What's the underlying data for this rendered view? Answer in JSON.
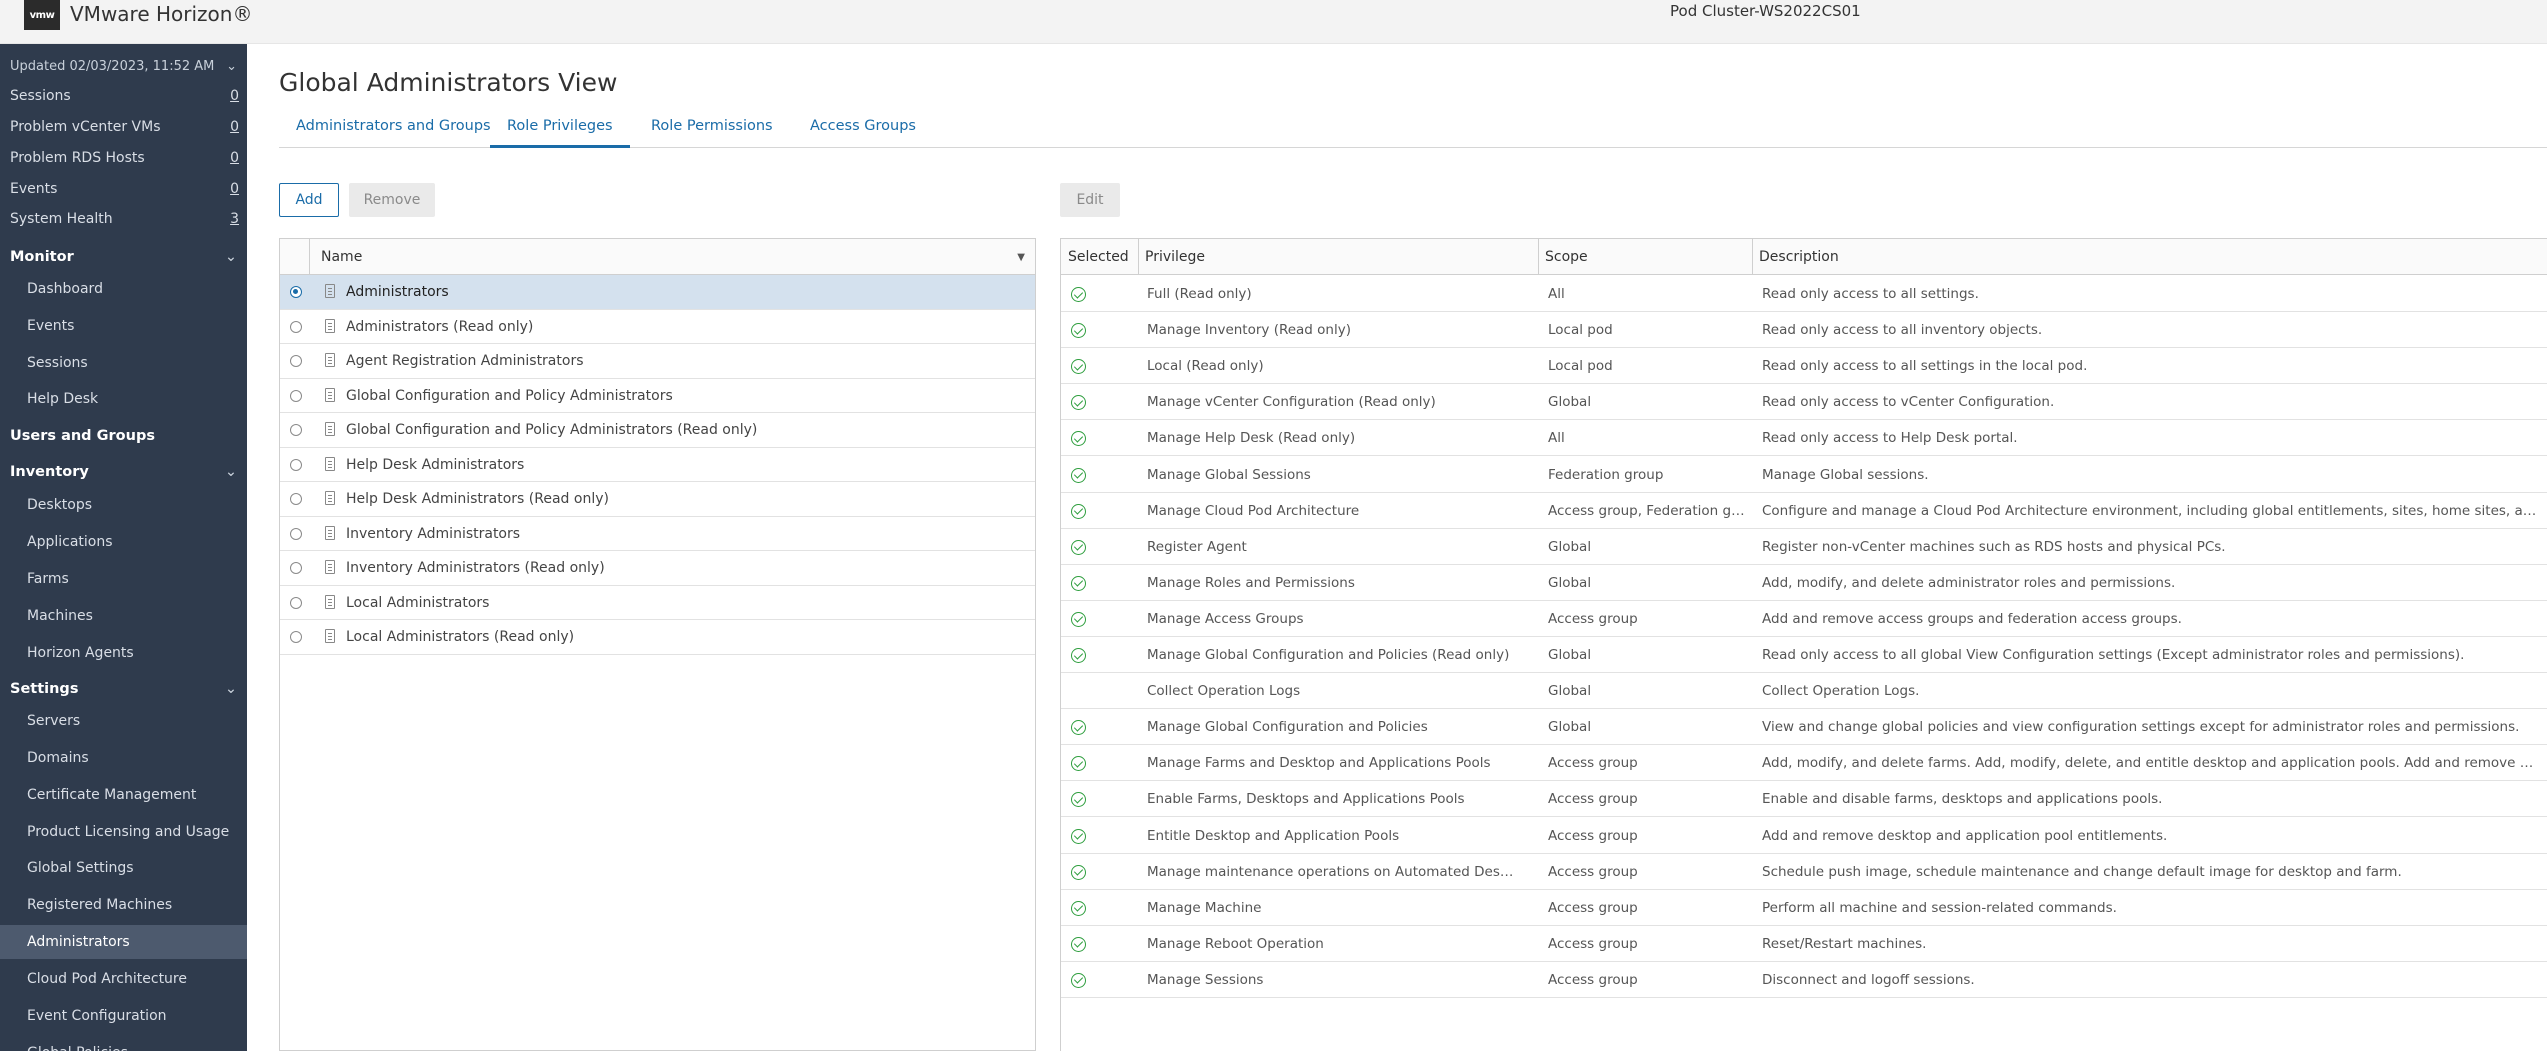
{
  "header": {
    "logo": "vmw",
    "app_title": "VMware Horizon®",
    "pod_title": "Pod Cluster-WS2022CS01"
  },
  "sidebar": {
    "updated": "Updated 02/03/2023, 11:52 AM",
    "stats": [
      {
        "label": "Sessions",
        "count": "0"
      },
      {
        "label": "Problem vCenter VMs",
        "count": "0"
      },
      {
        "label": "Problem RDS Hosts",
        "count": "0"
      },
      {
        "label": "Events",
        "count": "0"
      },
      {
        "label": "System Health",
        "count": "3"
      }
    ],
    "monitor": {
      "label": "Monitor",
      "items": [
        "Dashboard",
        "Events",
        "Sessions",
        "Help Desk"
      ]
    },
    "users_and_groups": "Users and Groups",
    "inventory": {
      "label": "Inventory",
      "items": [
        "Desktops",
        "Applications",
        "Farms",
        "Machines",
        "Horizon Agents"
      ]
    },
    "settings": {
      "label": "Settings",
      "items": [
        "Servers",
        "Domains",
        "Certificate Management",
        "Product Licensing and Usage",
        "Global Settings",
        "Registered Machines",
        "Administrators",
        "Cloud Pod Architecture",
        "Event Configuration",
        "Global Policies"
      ]
    }
  },
  "main": {
    "title": "Global Administrators View",
    "tabs": [
      "Administrators and Groups",
      "Role Privileges",
      "Role Permissions",
      "Access Groups"
    ],
    "active_tab": "Role Privileges",
    "buttons": {
      "add": "Add",
      "remove": "Remove",
      "edit": "Edit"
    }
  },
  "roles_table": {
    "name_header": "Name",
    "filter_icon": "▼",
    "selected": "Administrators",
    "rows": [
      "Administrators",
      "Administrators (Read only)",
      "Agent Registration Administrators",
      "Global Configuration and Policy Administrators",
      "Global Configuration and Policy Administrators (Read only)",
      "Help Desk Administrators",
      "Help Desk Administrators (Read only)",
      "Inventory Administrators",
      "Inventory Administrators (Read only)",
      "Local Administrators",
      "Local Administrators (Read only)"
    ]
  },
  "privileges_table": {
    "headers": {
      "selected": "Selected",
      "privilege": "Privilege",
      "scope": "Scope",
      "description": "Description"
    },
    "rows": [
      {
        "selected": true,
        "privilege": "Full (Read only)",
        "scope": "All",
        "description": "Read only access to all settings."
      },
      {
        "selected": true,
        "privilege": "Manage Inventory (Read only)",
        "scope": "Local pod",
        "description": "Read only access to all inventory objects."
      },
      {
        "selected": true,
        "privilege": "Local (Read only)",
        "scope": "Local pod",
        "description": "Read only access to all settings in the local pod."
      },
      {
        "selected": true,
        "privilege": "Manage vCenter Configuration (Read only)",
        "scope": "Global",
        "description": "Read only access to vCenter Configuration."
      },
      {
        "selected": true,
        "privilege": "Manage Help Desk (Read only)",
        "scope": "All",
        "description": "Read only access to Help Desk portal."
      },
      {
        "selected": true,
        "privilege": "Manage Global Sessions",
        "scope": "Federation group",
        "description": "Manage Global sessions."
      },
      {
        "selected": true,
        "privilege": "Manage Cloud Pod Architecture",
        "scope": "Access group, Federation group",
        "description": "Configure and manage a Cloud Pod Architecture environment, including global entitlements, sites, home sites, and pods."
      },
      {
        "selected": true,
        "privilege": "Register Agent",
        "scope": "Global",
        "description": "Register non-vCenter machines such as RDS hosts and physical PCs."
      },
      {
        "selected": true,
        "privilege": "Manage Roles and Permissions",
        "scope": "Global",
        "description": "Add, modify, and delete administrator roles and permissions."
      },
      {
        "selected": true,
        "privilege": "Manage Access Groups",
        "scope": "Access group",
        "description": "Add and remove access groups and federation access groups."
      },
      {
        "selected": true,
        "privilege": "Manage Global Configuration and Policies (Read only)",
        "scope": "Global",
        "description": "Read only access to all global View Configuration settings (Except administrator roles and permissions)."
      },
      {
        "selected": false,
        "privilege": "Collect Operation Logs",
        "scope": "Global",
        "description": "Collect Operation Logs."
      },
      {
        "selected": true,
        "privilege": "Manage Global Configuration and Policies",
        "scope": "Global",
        "description": "View and change global policies and view configuration settings except for administrator roles and permissions."
      },
      {
        "selected": true,
        "privilege": "Manage Farms and Desktop and Applications Pools",
        "scope": "Access group",
        "description": "Add, modify, and delete farms. Add, modify, delete, and entitle desktop and application pools. Add and remove machines."
      },
      {
        "selected": true,
        "privilege": "Enable Farms, Desktops and Applications Pools",
        "scope": "Access group",
        "description": "Enable and disable farms, desktops and applications pools."
      },
      {
        "selected": true,
        "privilege": "Entitle Desktop and Application Pools",
        "scope": "Access group",
        "description": "Add and remove desktop and application pool entitlements."
      },
      {
        "selected": true,
        "privilege": "Manage maintenance operations on Automated Desktops & ...",
        "scope": "Access group",
        "description": "Schedule push image, schedule maintenance and change default image for desktop and farm."
      },
      {
        "selected": true,
        "privilege": "Manage Machine",
        "scope": "Access group",
        "description": "Perform all machine and session-related commands."
      },
      {
        "selected": true,
        "privilege": "Manage Reboot Operation",
        "scope": "Access group",
        "description": "Reset/Restart machines."
      },
      {
        "selected": true,
        "privilege": "Manage Sessions",
        "scope": "Access group",
        "description": "Disconnect and logoff sessions."
      }
    ]
  }
}
